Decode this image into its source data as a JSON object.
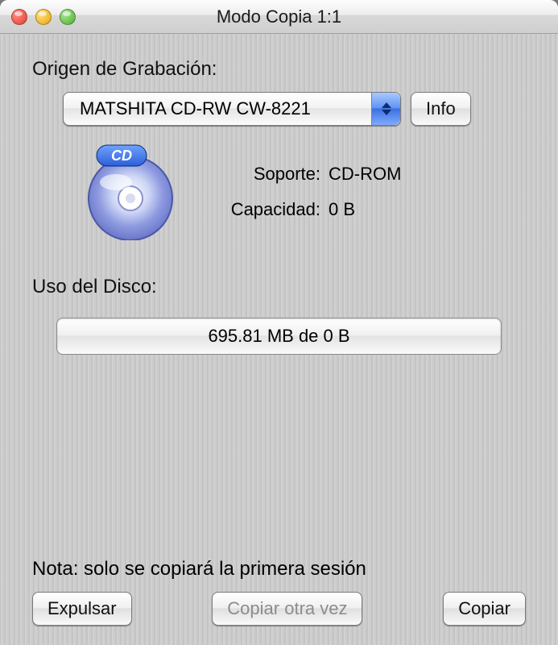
{
  "window": {
    "title": "Modo Copia 1:1"
  },
  "source": {
    "label": "Origen de Grabación:",
    "selected": "MATSHITA CD-RW CW-8221",
    "info_button": "Info"
  },
  "media": {
    "support_label": "Soporte:",
    "support_value": "CD-ROM",
    "capacity_label": "Capacidad:",
    "capacity_value": "0 B",
    "icon_badge": "CD"
  },
  "usage": {
    "label": "Uso del Disco:",
    "text": "695.81 MB de 0 B"
  },
  "note": "Nota: solo se copiará la primera sesión",
  "buttons": {
    "eject": "Expulsar",
    "copy_again": "Copiar otra vez",
    "copy": "Copiar"
  }
}
